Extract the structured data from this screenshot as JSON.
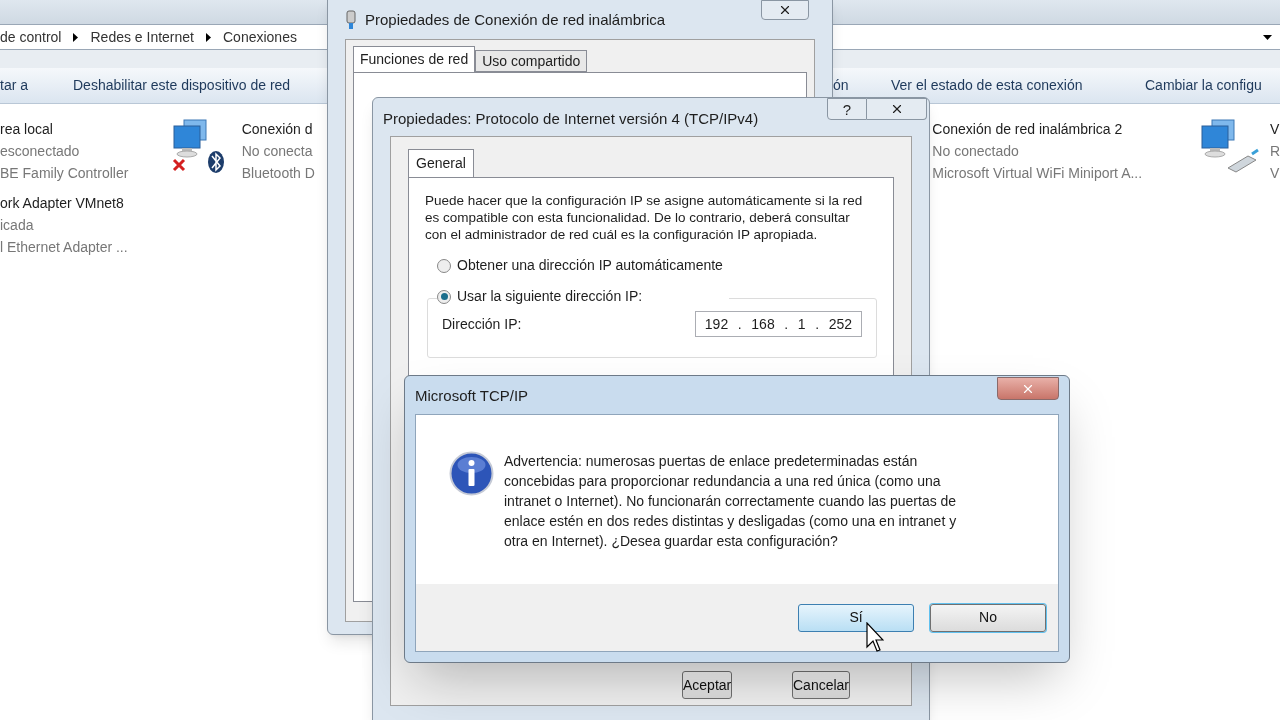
{
  "explorer": {
    "breadcrumb": [
      "de control",
      "Redes e Internet",
      "Conexiones"
    ],
    "toolbar": [
      "tar a",
      "Deshabilitar este dispositivo de red",
      "ón",
      "Ver el estado de esta conexión",
      "Cambiar la configu"
    ],
    "adapter_columns": [
      {
        "adapters": [
          {
            "kind": "none",
            "name": "rea local",
            "status": "esconectado",
            "device": "BE Family Controller"
          },
          {
            "kind": "none",
            "name": "ork Adapter VMnet8",
            "status": "icada",
            "device": "l Ethernet Adapter ..."
          }
        ]
      },
      {
        "adapters": [
          {
            "kind": "bluetooth",
            "name": "Conexión d",
            "status": "No conecta",
            "device": "Bluetooth D"
          }
        ]
      },
      {
        "adapters": [
          {
            "kind": "none",
            "name": "Conexión de red inalámbrica 2",
            "status": "No conectado",
            "device": "Microsoft Virtual WiFi Miniport A..."
          }
        ]
      },
      {
        "adapters": [
          {
            "kind": "wired",
            "name": "V",
            "status": "R",
            "device": "V"
          }
        ]
      }
    ]
  },
  "network_dialog": {
    "title": "Propiedades de Conexión de red inalámbrica",
    "tabs": [
      {
        "label": "Funciones de red",
        "selected": true
      },
      {
        "label": "Uso compartido",
        "selected": false
      }
    ]
  },
  "ipv4_dialog": {
    "title": "Propiedades: Protocolo de Internet versión 4 (TCP/IPv4)",
    "help_label": "?",
    "tabs": [
      {
        "label": "General",
        "selected": true
      }
    ],
    "description": "Puede hacer que la configuración IP se asigne automáticamente si la red es compatible con esta funcionalidad. De lo contrario, deberá consultar con el administrador de red cuál es la configuración IP apropiada.",
    "radios": [
      {
        "label": "Obtener una dirección IP automáticamente",
        "selected": false
      },
      {
        "label": "Usar la siguiente dirección IP:",
        "selected": true
      }
    ],
    "ip_label": "Dirección IP:",
    "ip_octets": [
      "192",
      "168",
      "1",
      "252"
    ],
    "ip_separator": ".",
    "buttons": [
      "Aceptar",
      "Cancelar"
    ]
  },
  "alert_dialog": {
    "title": "Microsoft TCP/IP",
    "message": "Advertencia: numerosas puertas de enlace predeterminadas están concebidas para proporcionar redundancia a una red única (como una intranet o Internet). No funcionarán correctamente cuando las puertas de enlace estén en dos redes distintas y desligadas (como una en intranet y otra en Internet). ¿Desea guardar esta configuración?",
    "buttons": [
      {
        "label": "Sí",
        "hovered": true
      },
      {
        "label": "No",
        "hovered": false
      }
    ]
  }
}
